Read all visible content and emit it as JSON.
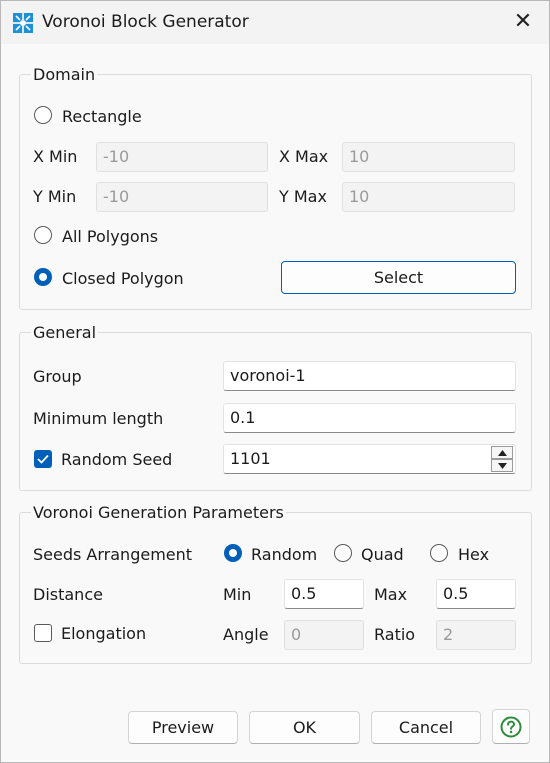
{
  "window": {
    "title": "Voronoi Block Generator",
    "app_icon": "voronoi-icon",
    "close_glyph": "✕"
  },
  "domain": {
    "title": "Domain",
    "rectangle_label": "Rectangle",
    "xmin_label": "X Min",
    "xmin_value": "-10",
    "xmax_label": "X Max",
    "xmax_value": "10",
    "ymin_label": "Y Min",
    "ymin_value": "-10",
    "ymax_label": "Y Max",
    "ymax_value": "10",
    "all_polygons_label": "All Polygons",
    "closed_polygon_label": "Closed Polygon",
    "selected": "Closed Polygon",
    "select_button": "Select"
  },
  "general": {
    "title": "General",
    "group_label": "Group",
    "group_value": "voronoi-1",
    "min_length_label": "Minimum length",
    "min_length_value": "0.1",
    "random_seed_label": "Random Seed",
    "random_seed_checked": true,
    "random_seed_value": "1101"
  },
  "params": {
    "title": "Voronoi Generation Parameters",
    "seeds_label": "Seeds Arrangement",
    "seed_options": [
      "Random",
      "Quad",
      "Hex"
    ],
    "seed_selected": "Random",
    "distance_label": "Distance",
    "min_label": "Min",
    "min_value": "0.5",
    "max_label": "Max",
    "max_value": "0.5",
    "elongation_label": "Elongation",
    "elongation_checked": false,
    "angle_label": "Angle",
    "angle_value": "0",
    "ratio_label": "Ratio",
    "ratio_value": "2"
  },
  "buttons": {
    "preview": "Preview",
    "ok": "OK",
    "cancel": "Cancel",
    "help_icon": "help-icon"
  },
  "colors": {
    "accent": "#005fb8",
    "help": "#2e8b3a"
  }
}
